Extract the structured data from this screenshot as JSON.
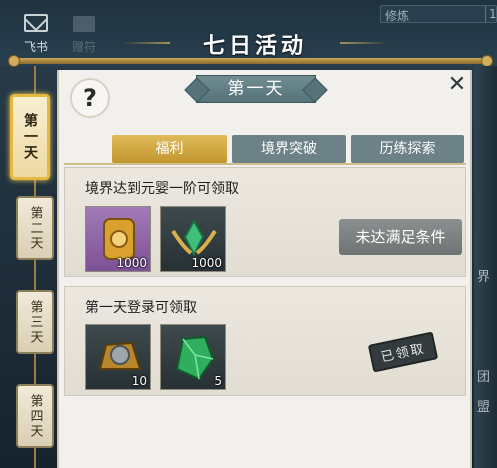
{
  "header": {
    "mail_label": "飞书",
    "gift_label": "赠符",
    "search_text": "修炼",
    "search_num": "1",
    "title": "七日活动"
  },
  "side_tabs": [
    {
      "label": "第一天",
      "active": true
    },
    {
      "label": "第二天",
      "active": false
    },
    {
      "label": "第三天",
      "active": false
    },
    {
      "label": "第四天",
      "active": false
    }
  ],
  "panel": {
    "help_symbol": "?",
    "day_title": "第一天",
    "close_symbol": "✕",
    "tabs": [
      "福利",
      "境界突破",
      "历练探索"
    ],
    "rewards": [
      {
        "condition": "境界达到元婴一阶可领取",
        "items": [
          {
            "icon": "golden-token-icon",
            "qty": "1000"
          },
          {
            "icon": "green-crystal-emblem-icon",
            "qty": "1000"
          }
        ],
        "status_button": "未达满足条件"
      },
      {
        "condition": "第一天登录可领取",
        "items": [
          {
            "icon": "golden-pouch-icon",
            "qty": "10"
          },
          {
            "icon": "green-gem-icon",
            "qty": "5"
          }
        ],
        "claimed_stamp": "已领取"
      }
    ]
  },
  "right_edge": [
    "界",
    "团",
    "盟"
  ],
  "colors": {
    "accent_gold": "#e5b840",
    "tab_active": "#c9a040",
    "tab_inactive": "#6d8286",
    "banner": "#5f7c82"
  }
}
